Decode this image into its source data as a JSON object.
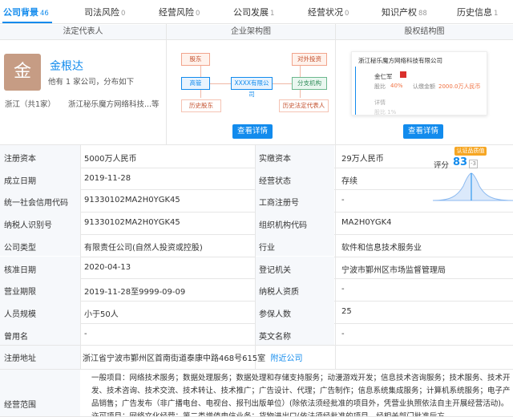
{
  "tabs": [
    {
      "label": "公司背景",
      "count": "46"
    },
    {
      "label": "司法风险",
      "count": "0"
    },
    {
      "label": "经营风险",
      "count": "0"
    },
    {
      "label": "公司发展",
      "count": "1"
    },
    {
      "label": "经营状况",
      "count": "0"
    },
    {
      "label": "知识产权",
      "count": "88"
    },
    {
      "label": "历史信息",
      "count": "1"
    }
  ],
  "sections": {
    "legal_rep": "法定代表人",
    "structure": "企业架构图",
    "equity": "股权结构图"
  },
  "legal_rep": {
    "avatar": "金",
    "name": "金根达",
    "sub": "他有 1 家公司，分布如下",
    "region": "浙江（共1家）",
    "company": "浙江秘乐魔方网络科技...等"
  },
  "diagram": {
    "shareholder": "股东",
    "executive": "高管",
    "history_shareholder": "历史股东",
    "center": "XXXX有限公司",
    "investment": "对外投资",
    "branch": "分支机构",
    "history_rep": "历史法定代表人"
  },
  "equity": {
    "company": "浙江秘乐魔方网络科技有限公司",
    "holder": "金仁军",
    "ratio_label": "股比",
    "ratio": "40%",
    "capital_label": "认缴金额",
    "capital": "2000.0万人民币",
    "fade1": "详情",
    "fade2": "股比 1%"
  },
  "view_details": "查看详情",
  "rating": {
    "badge": "认证品质值",
    "label": "评分",
    "value": "83",
    "trend": "-3"
  },
  "rows": [
    {
      "l1": "注册资本",
      "v1": "5000万人民币",
      "l2": "实缴资本",
      "v2": "29万人民币"
    },
    {
      "l1": "成立日期",
      "v1": "2019-11-28",
      "l2": "经营状态",
      "v2": "存续"
    },
    {
      "l1": "统一社会信用代码",
      "v1": "91330102MA2H0YGK45",
      "l2": "工商注册号",
      "v2": "-"
    },
    {
      "l1": "纳税人识别号",
      "v1": "91330102MA2H0YGK45",
      "l2": "组织机构代码",
      "v2": "MA2H0YGK4"
    },
    {
      "l1": "公司类型",
      "v1": "有限责任公司(自然人投资或控股)",
      "l2": "行业",
      "v2": "软件和信息技术服务业"
    },
    {
      "l1": "核准日期",
      "v1": "2020-04-13",
      "l2": "登记机关",
      "v2": "宁波市鄞州区市场监督管理局"
    },
    {
      "l1": "营业期限",
      "v1": "2019-11-28至9999-09-09",
      "l2": "纳税人资质",
      "v2": "-"
    },
    {
      "l1": "人员规模",
      "v1": "小于50人",
      "l2": "参保人数",
      "v2": "25"
    },
    {
      "l1": "曾用名",
      "v1": "-",
      "l2": "英文名称",
      "v2": "-"
    }
  ],
  "address": {
    "label": "注册地址",
    "value": "浙江省宁波市鄞州区首南街道泰康中路468号615室",
    "link": "附近公司"
  },
  "scope": {
    "label": "经营范围",
    "text": "一般项目：网络技术服务；数据处理服务；数据处理和存储支持服务；动漫游戏开发；信息技术咨询服务；技术服务、技术开发、技术咨询、技术交流、技术转让、技术推广；广告设计、代理；广告制作；信息系统集成服务；计算机系统服务；电子产品销售；广告发布（非广播电台、电视台、报刊出版单位）(除依法须经批准的项目外，凭营业执照依法自主开展经营活动)。许可项目：网络文化经营；第二类增值电信业务；货物进出口(依法须经批准的项目，经相关部门批准后方"
  },
  "colors": {
    "accent": "#128bed",
    "label_bg": "#f6f8fb",
    "border": "#e6e6e6"
  }
}
